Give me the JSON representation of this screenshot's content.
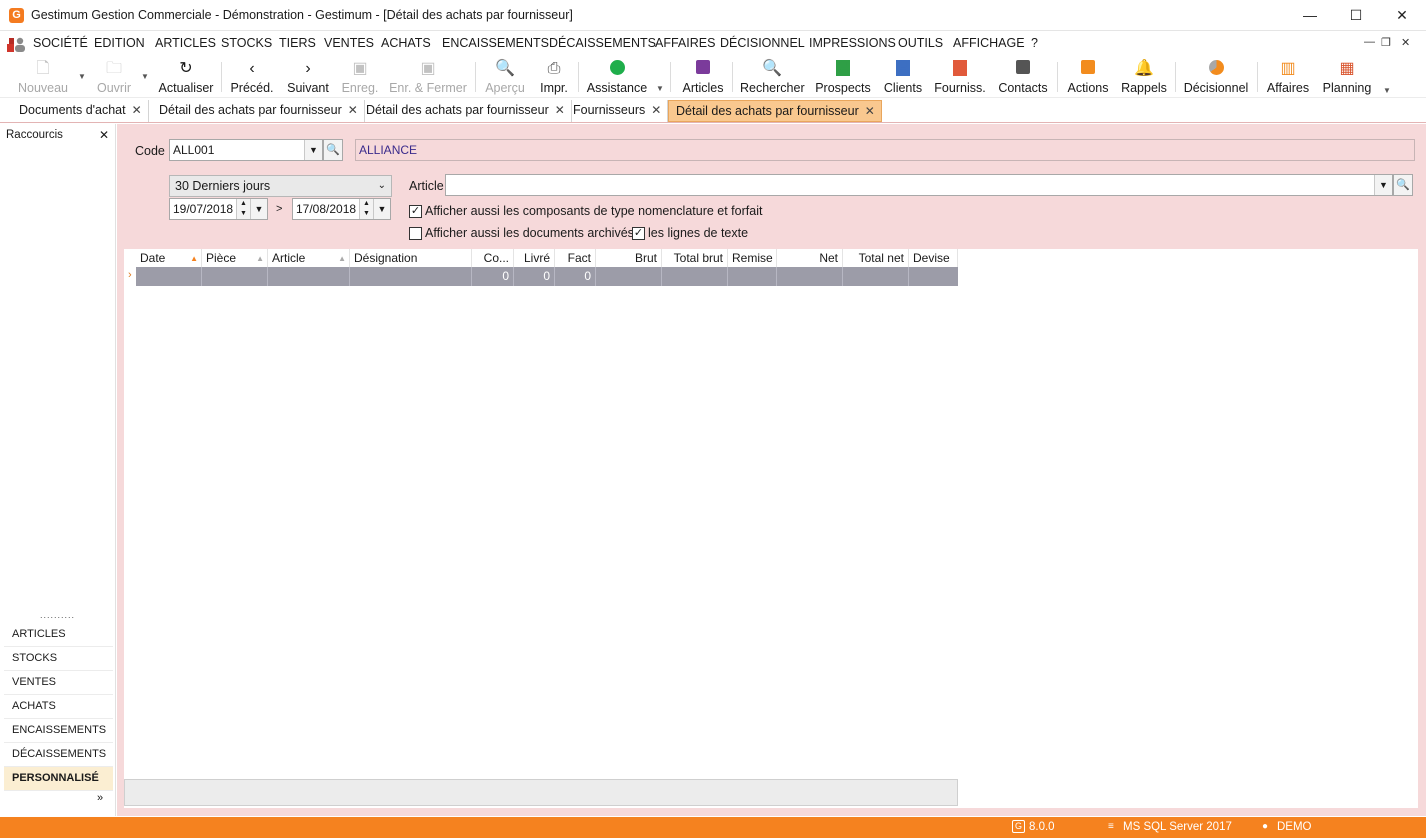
{
  "window": {
    "title": "Gestimum Gestion Commerciale - Démonstration - Gestimum - [Détail des achats par fournisseur]",
    "logo": "G",
    "minimize": "—",
    "maximize": "☐",
    "close": "✕"
  },
  "menu": {
    "items": [
      "SOCIÉTÉ",
      "EDITION",
      "ARTICLES",
      "STOCKS",
      "TIERS",
      "VENTES",
      "ACHATS",
      "ENCAISSEMENTS",
      "DÉCAISSEMENTS",
      "AFFAIRES",
      "DÉCISIONNEL",
      "IMPRESSIONS",
      "OUTILS",
      "AFFICHAGE",
      "?"
    ],
    "ctrl_min": "—",
    "ctrl_restore": "❐",
    "ctrl_close": "✕"
  },
  "toolbar": {
    "nouveau": "Nouveau",
    "ouvrir": "Ouvrir",
    "actualiser": "Actualiser",
    "preced": "Précéd.",
    "suivant": "Suivant",
    "enreg": "Enreg.",
    "enr_fermer": "Enr. & Fermer",
    "apercu": "Aperçu",
    "impr": "Impr.",
    "assistance": "Assistance",
    "articles": "Articles",
    "rechercher": "Rechercher",
    "prospects": "Prospects",
    "clients": "Clients",
    "fourniss": "Fourniss.",
    "contacts": "Contacts",
    "actions": "Actions",
    "rappels": "Rappels",
    "decisionnel": "Décisionnel",
    "affaires": "Affaires",
    "planning": "Planning"
  },
  "tabs": [
    {
      "label": "Documents d'achat"
    },
    {
      "label": "Détail des achats par fournisseur"
    },
    {
      "label": "Détail des achats par fournisseur"
    },
    {
      "label": "Fournisseurs"
    },
    {
      "label": "Détail des achats par fournisseur"
    }
  ],
  "sidebar": {
    "title": "Raccourcis",
    "grip": "..........",
    "items": [
      "ARTICLES",
      "STOCKS",
      "VENTES",
      "ACHATS",
      "ENCAISSEMENTS",
      "DÉCAISSEMENTS",
      "PERSONNALISÉ"
    ],
    "more": "»"
  },
  "form": {
    "code_label": "Code",
    "code_value": "ALL001",
    "supplier_name": "ALLIANCE",
    "period": "30 Derniers jours",
    "date_from": "19/07/2018",
    "date_to": "17/08/2018",
    "range_sep": ">",
    "article_label": "Article",
    "article_value": "",
    "chk_nomenclature": "Afficher aussi les composants de type nomenclature et forfait",
    "chk_nomenclature_checked": true,
    "chk_archives": "Afficher aussi les documents archivés",
    "chk_archives_checked": false,
    "chk_text_lines": "les lignes de texte",
    "chk_text_lines_checked": true
  },
  "grid": {
    "columns": [
      "Date",
      "Pièce",
      "Article",
      "Désignation",
      "Co...",
      "Livré",
      "Fact",
      "Brut",
      "Total brut",
      "Remise",
      "Net",
      "Total net",
      "Devise"
    ],
    "row": [
      "",
      "",
      "",
      "",
      "0",
      "0",
      "0",
      "",
      "",
      "",
      "",
      "",
      ""
    ],
    "row_indicator": "›"
  },
  "status": {
    "version": "8.0.0",
    "server": "MS SQL Server 2017",
    "user": "DEMO"
  },
  "colors": {
    "accent": "#f5821f",
    "content_bg": "#f6d9da",
    "active_tab": "#f9c88f",
    "supplier_name": "#3a2a8c"
  }
}
